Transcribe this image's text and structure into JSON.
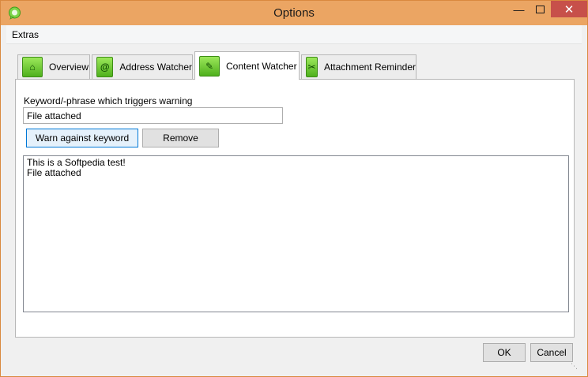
{
  "window": {
    "title": "Options"
  },
  "icons": {
    "app": "chat-bubble-icon",
    "minimize": "minimize-icon",
    "maximize": "maximize-icon",
    "close": "close-icon"
  },
  "menu": {
    "items": [
      "Extras"
    ]
  },
  "tabs": [
    {
      "label": "Overview",
      "icon": "home-icon",
      "glyph": "⌂",
      "active": false
    },
    {
      "label": "Address Watcher",
      "icon": "at-sign-icon",
      "glyph": "@",
      "active": false
    },
    {
      "label": "Content Watcher",
      "icon": "edit-document-icon",
      "glyph": "✎",
      "active": true
    },
    {
      "label": "Attachment Reminder",
      "icon": "paperclip-icon",
      "glyph": "✂",
      "active": false
    }
  ],
  "content_watcher": {
    "keyword_label": "Keyword/-phrase which triggers warning",
    "keyword_value": "File attached",
    "warn_button": "Warn against keyword",
    "remove_button": "Remove",
    "keywords": [
      "This is a Softpedia test!",
      "File attached"
    ]
  },
  "footer": {
    "ok": "OK",
    "cancel": "Cancel"
  },
  "colors": {
    "titlebar": "#eba563",
    "close_button": "#c7504a",
    "tab_icon_green": "#6cc733",
    "focus_blue": "#0078d7"
  }
}
